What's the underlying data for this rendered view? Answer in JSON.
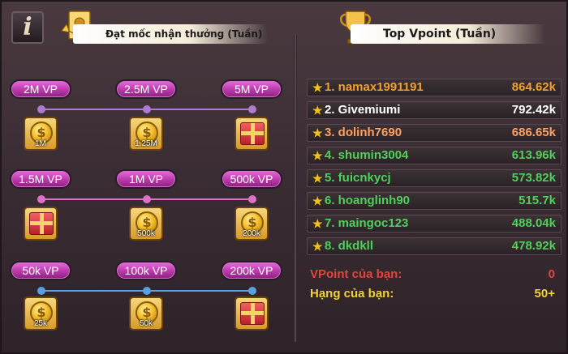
{
  "left": {
    "title": "Đạt mốc nhận thưởng (Tuần)",
    "rows": [
      {
        "milestones": [
          "2M VP",
          "2.5M VP",
          "5M VP"
        ],
        "rewards": [
          {
            "type": "coin",
            "amount": "1M"
          },
          {
            "type": "coin",
            "amount": "1.25M"
          },
          {
            "type": "gift",
            "amount": ""
          }
        ],
        "line_color": "#b07ad0"
      },
      {
        "milestones": [
          "1.5M VP",
          "1M VP",
          "500k VP"
        ],
        "rewards": [
          {
            "type": "gift",
            "amount": ""
          },
          {
            "type": "coin",
            "amount": "500k"
          },
          {
            "type": "coin",
            "amount": "200k"
          }
        ],
        "line_color": "#e070c8"
      },
      {
        "milestones": [
          "50k VP",
          "100k VP",
          "200k VP"
        ],
        "rewards": [
          {
            "type": "coin",
            "amount": "25k"
          },
          {
            "type": "coin",
            "amount": "50k"
          },
          {
            "type": "gift",
            "amount": ""
          }
        ],
        "line_color": "#5aa0e0"
      }
    ]
  },
  "right": {
    "title": "Top Vpoint (Tuần)",
    "leaderboard": [
      {
        "rank_name": "1. namax1991191",
        "points": "864.62k",
        "color": "#f0a030"
      },
      {
        "rank_name": "2. Givemiumi",
        "points": "792.42k",
        "color": "#ffffff"
      },
      {
        "rank_name": "3. dolinh7690",
        "points": "686.65k",
        "color": "#ffa060"
      },
      {
        "rank_name": "4. shumin3004",
        "points": "613.96k",
        "color": "#4ed05a"
      },
      {
        "rank_name": "5. fuicnkycj",
        "points": "573.82k",
        "color": "#4ed05a"
      },
      {
        "rank_name": "6. hoanglinh90",
        "points": "515.7k",
        "color": "#4ed05a"
      },
      {
        "rank_name": "7. maingoc123",
        "points": "488.04k",
        "color": "#4ed05a"
      },
      {
        "rank_name": "8. dkdkll",
        "points": "478.92k",
        "color": "#4ed05a"
      }
    ],
    "my_vpoint_label": "VPoint của bạn:",
    "my_vpoint_value": "0",
    "my_rank_label": "Hạng của bạn:",
    "my_rank_value": "50+"
  },
  "colors": {
    "vpoint_label": "#e0463c",
    "rank_label": "#f2d23a"
  },
  "icons": {
    "info": "info-icon",
    "envelope": "gold-envelope-icon",
    "trophy": "trophy-icon",
    "star": "star-icon",
    "coin": "gold-coin-icon",
    "gift": "gift-box-icon"
  }
}
